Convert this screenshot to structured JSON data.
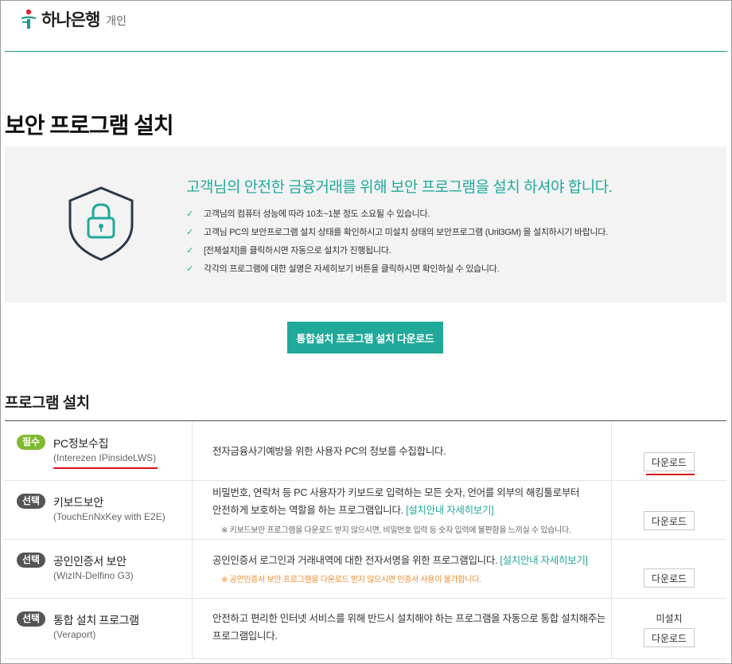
{
  "header": {
    "bank_name": "하나은행",
    "section": "개인"
  },
  "page_title": "보안 프로그램 설치",
  "notice": {
    "title": "고객님의 안전한 금융거래를 위해 보안 프로그램을 설치 하셔야 합니다.",
    "items": [
      "고객님의 컴퓨터 성능에 따라 10초~1분 정도 소요될 수 있습니다.",
      "고객님 PC의 보안프로그램 설치 상태를 확인하시고 미설치 상태의 보안프로그램 (Uril3GM) 을 설치하시기 바랍니다.",
      "[전체설치]를 클릭하시면 자동으로 설치가 진행됩니다.",
      "각각의 프로그램에 대한 설명은 자세히보기 버튼을 클릭하시면 확인하실 수 있습니다."
    ]
  },
  "install_all_button": "통합설치 프로그램 설치 다운로드",
  "section_title": "프로그램 설치",
  "programs": [
    {
      "badge": "필수",
      "name": "PC정보수집",
      "sub": "(Interezen IPinsideLWS)",
      "desc_lines": [
        "전자금융사기예방을 위한 사용자 PC의 정보를 수집합니다."
      ],
      "button": "다운로드"
    },
    {
      "badge": "선택",
      "name": "키보드보안",
      "sub": "(TouchEnNxKey with E2E)",
      "desc_line1": "비밀번호, 연락처 등 PC 사용자가 키보드로 입력하는 모든 숫자, 언어를 외부의 해킹툴로부터",
      "desc_line2": "안전하게 보호하는 역할을 하는 프로그램입니다.",
      "link": "[설치안내 자세히보기]",
      "note": "※ 키보드보안 프로그램을 다운로드 받지 않으시면, 비밀번호 입력 등 숫자 입력에 불편함을 느끼실 수 있습니다.",
      "button": "다운로드"
    },
    {
      "badge": "선택",
      "name": "공인인증서 보안",
      "sub": "(WizIN-Delfino G3)",
      "desc_line1": "공인인증서 로그인과 거래내역에 대한 전자서명을 위한 프로그램입니다.",
      "link": "[설치안내 자세히보기]",
      "note": "※ 공인인증서 보안 프로그램을 다운로드 받지 않으시면 인증서 사용이 불가합니다.",
      "button": "다운로드"
    },
    {
      "badge": "선택",
      "name": "통합 설치 프로그램",
      "sub": "(Veraport)",
      "desc_line1": "안전하고 편리한 인터넷 서비스를 위해 반드시 설치해야 하는 프로그램을 자동으로 통합 설치해주는",
      "desc_line2": "프로그램입니다.",
      "status": "미설치",
      "button": "다운로드"
    }
  ],
  "colors": {
    "accent": "#1fa99b",
    "required_badge": "#7fba2f",
    "optional_badge": "#555555",
    "warning": "#f08a2a",
    "annotation_underline": "#e0101a"
  }
}
